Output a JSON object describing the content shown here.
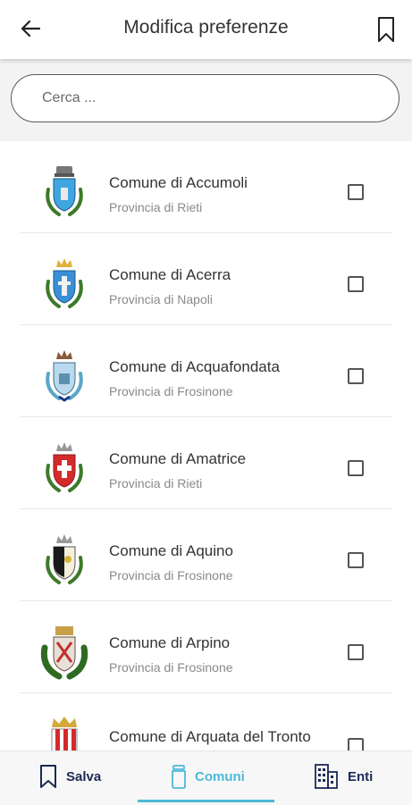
{
  "header": {
    "title": "Modifica preferenze"
  },
  "search": {
    "placeholder": "Cerca ..."
  },
  "items": [
    {
      "name": "Comune di Accumoli",
      "province": "Provincia di Rieti",
      "checked": false
    },
    {
      "name": "Comune di Acerra",
      "province": "Provincia di Napoli",
      "checked": false
    },
    {
      "name": "Comune di Acquafondata",
      "province": "Provincia di Frosinone",
      "checked": false
    },
    {
      "name": "Comune di Amatrice",
      "province": "Provincia di Rieti",
      "checked": false
    },
    {
      "name": "Comune di Aquino",
      "province": "Provincia di Frosinone",
      "checked": false
    },
    {
      "name": "Comune di Arpino",
      "province": "Provincia di Frosinone",
      "checked": false
    },
    {
      "name": "Comune di Arquata del Tronto",
      "province": "",
      "checked": false
    }
  ],
  "nav": {
    "tabs": [
      {
        "label": "Salva",
        "icon": "bookmark-icon",
        "active": false
      },
      {
        "label": "Comuni",
        "icon": "trash-icon",
        "active": true
      },
      {
        "label": "Enti",
        "icon": "building-icon",
        "active": false
      }
    ]
  },
  "colors": {
    "accent": "#4db8d6",
    "navy": "#1c2a55"
  }
}
